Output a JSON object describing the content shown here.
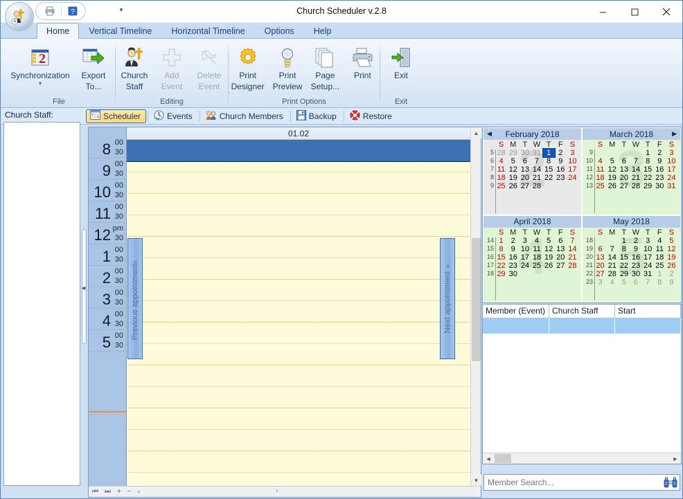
{
  "window": {
    "title": "Church Scheduler v.2.8",
    "app_icon": "church-staff-orb-icon",
    "minimize_label": "Minimize",
    "maximize_label": "Maximize",
    "close_label": "Close"
  },
  "quick_access": {
    "items": [
      {
        "name": "print-icon",
        "label": "Print"
      },
      {
        "name": "help-icon",
        "label": "Help"
      }
    ],
    "customize_label": "Customize Quick Access Toolbar"
  },
  "ribbon": {
    "tabs": [
      {
        "label": "Home",
        "active": true
      },
      {
        "label": "Vertical Timeline",
        "active": false
      },
      {
        "label": "Horizontal Timeline",
        "active": false
      },
      {
        "label": "Options",
        "active": false
      },
      {
        "label": "Help",
        "active": false
      }
    ],
    "groups": [
      {
        "label": "File",
        "items": [
          {
            "label1": "Synchronization",
            "label2": "",
            "icon": "synchronization-icon",
            "disabled": false,
            "dropdown": true
          },
          {
            "label1": "Export",
            "label2": "To...",
            "icon": "export-to-icon",
            "disabled": false,
            "dropdown": true
          }
        ]
      },
      {
        "label": "Editing",
        "items": [
          {
            "label1": "Church",
            "label2": "Staff",
            "icon": "church-staff-icon",
            "disabled": false,
            "dropdown": false
          },
          {
            "label1": "Add",
            "label2": "Event",
            "icon": "add-event-icon",
            "disabled": true,
            "dropdown": false
          },
          {
            "label1": "Delete",
            "label2": "Event",
            "icon": "delete-event-icon",
            "disabled": true,
            "dropdown": true
          }
        ]
      },
      {
        "label": "Print Options",
        "items": [
          {
            "label1": "Print",
            "label2": "Designer",
            "icon": "print-designer-icon",
            "disabled": false,
            "dropdown": false
          },
          {
            "label1": "Print",
            "label2": "Preview",
            "icon": "print-preview-icon",
            "disabled": false,
            "dropdown": false
          },
          {
            "label1": "Page",
            "label2": "Setup...",
            "icon": "page-setup-icon",
            "disabled": false,
            "dropdown": false
          },
          {
            "label1": "Print",
            "label2": "",
            "icon": "print-icon",
            "disabled": false,
            "dropdown": false
          }
        ]
      },
      {
        "label": "Exit",
        "items": [
          {
            "label1": "Exit",
            "label2": "",
            "icon": "exit-icon",
            "disabled": false,
            "dropdown": false
          }
        ]
      }
    ]
  },
  "nav_tabs": [
    {
      "label": "Scheduler",
      "icon": "scheduler-grid-icon",
      "active": true
    },
    {
      "label": "Events",
      "icon": "events-clock-icon",
      "active": false
    },
    {
      "label": "Church Members",
      "icon": "church-members-icon",
      "active": false
    },
    {
      "label": "Backup",
      "icon": "backup-floppy-icon",
      "active": false
    },
    {
      "label": "Restore",
      "icon": "restore-lifering-icon",
      "active": false
    }
  ],
  "staff_panel": {
    "title": "Church Staff:",
    "items": []
  },
  "scheduler": {
    "date_header": "01.02",
    "prev_appointment_label": "Previous appointment",
    "next_appointment_label": "Next appointment",
    "prev_chevron": "«",
    "next_chevron": "»",
    "time_rows": [
      {
        "hour": "8",
        "suffix": "00",
        "half": "30"
      },
      {
        "hour": "9",
        "suffix": "00",
        "half": "30"
      },
      {
        "hour": "10",
        "suffix": "00",
        "half": "30"
      },
      {
        "hour": "11",
        "suffix": "00",
        "half": "30"
      },
      {
        "hour": "12",
        "suffix": "pm",
        "half": "30"
      },
      {
        "hour": "1",
        "suffix": "00",
        "half": "30"
      },
      {
        "hour": "2",
        "suffix": "00",
        "half": "30"
      },
      {
        "hour": "3",
        "suffix": "00",
        "half": "30"
      },
      {
        "hour": "4",
        "suffix": "00",
        "half": "30"
      },
      {
        "hour": "5",
        "suffix": "00",
        "half": "30"
      }
    ],
    "nav_buttons": [
      {
        "name": "first-record-button",
        "glyph": "⏮"
      },
      {
        "name": "last-record-button",
        "glyph": "⏭"
      },
      {
        "name": "add-record-button",
        "glyph": "+"
      },
      {
        "name": "delete-record-button",
        "glyph": "−"
      },
      {
        "name": "prev-record-button",
        "glyph": "‹"
      },
      {
        "name": "next-record-button",
        "glyph": "›"
      }
    ]
  },
  "calendars": [
    {
      "title": "February 2018",
      "watermark": "2",
      "theme": "grey",
      "nav": "prev",
      "nav_glyph": "◀",
      "dow": [
        "S",
        "M",
        "T",
        "W",
        "T",
        "F",
        "S"
      ],
      "weeks": [
        {
          "wn": "5",
          "days": [
            {
              "d": "28",
              "t": "out-we"
            },
            {
              "d": "29",
              "t": "out"
            },
            {
              "d": "30",
              "t": "out"
            },
            {
              "d": "31",
              "t": "out"
            },
            {
              "d": "1",
              "t": "sel"
            },
            {
              "d": "2",
              "t": "nor"
            },
            {
              "d": "3",
              "t": "we"
            }
          ]
        },
        {
          "wn": "6",
          "days": [
            {
              "d": "4",
              "t": "we"
            },
            {
              "d": "5",
              "t": "nor"
            },
            {
              "d": "6",
              "t": "nor"
            },
            {
              "d": "7",
              "t": "nor"
            },
            {
              "d": "8",
              "t": "nor"
            },
            {
              "d": "9",
              "t": "nor"
            },
            {
              "d": "10",
              "t": "we"
            }
          ]
        },
        {
          "wn": "7",
          "days": [
            {
              "d": "11",
              "t": "we"
            },
            {
              "d": "12",
              "t": "nor"
            },
            {
              "d": "13",
              "t": "nor"
            },
            {
              "d": "14",
              "t": "nor"
            },
            {
              "d": "15",
              "t": "nor"
            },
            {
              "d": "16",
              "t": "nor"
            },
            {
              "d": "17",
              "t": "we"
            }
          ]
        },
        {
          "wn": "8",
          "days": [
            {
              "d": "18",
              "t": "we"
            },
            {
              "d": "19",
              "t": "nor"
            },
            {
              "d": "20",
              "t": "nor"
            },
            {
              "d": "21",
              "t": "nor"
            },
            {
              "d": "22",
              "t": "nor"
            },
            {
              "d": "23",
              "t": "nor"
            },
            {
              "d": "24",
              "t": "we"
            }
          ]
        },
        {
          "wn": "9",
          "days": [
            {
              "d": "25",
              "t": "we"
            },
            {
              "d": "26",
              "t": "nor"
            },
            {
              "d": "27",
              "t": "nor"
            },
            {
              "d": "28",
              "t": "nor"
            },
            {
              "d": "",
              "t": "nor"
            },
            {
              "d": "",
              "t": "nor"
            },
            {
              "d": "",
              "t": "nor"
            }
          ]
        }
      ]
    },
    {
      "title": "March 2018",
      "watermark": "3",
      "theme": "green",
      "nav": "next",
      "nav_glyph": "▶",
      "dow": [
        "S",
        "M",
        "T",
        "W",
        "T",
        "F",
        "S"
      ],
      "weeks": [
        {
          "wn": "9",
          "days": [
            {
              "d": "",
              "t": "nor"
            },
            {
              "d": "",
              "t": "nor"
            },
            {
              "d": "",
              "t": "nor"
            },
            {
              "d": "",
              "t": "nor"
            },
            {
              "d": "1",
              "t": "nor"
            },
            {
              "d": "2",
              "t": "nor"
            },
            {
              "d": "3",
              "t": "we"
            }
          ]
        },
        {
          "wn": "10",
          "days": [
            {
              "d": "4",
              "t": "we"
            },
            {
              "d": "5",
              "t": "nor"
            },
            {
              "d": "6",
              "t": "nor"
            },
            {
              "d": "7",
              "t": "nor"
            },
            {
              "d": "8",
              "t": "nor"
            },
            {
              "d": "9",
              "t": "nor"
            },
            {
              "d": "10",
              "t": "we"
            }
          ]
        },
        {
          "wn": "11",
          "days": [
            {
              "d": "11",
              "t": "we"
            },
            {
              "d": "12",
              "t": "nor"
            },
            {
              "d": "13",
              "t": "nor"
            },
            {
              "d": "14",
              "t": "nor"
            },
            {
              "d": "15",
              "t": "nor"
            },
            {
              "d": "16",
              "t": "nor"
            },
            {
              "d": "17",
              "t": "we"
            }
          ]
        },
        {
          "wn": "12",
          "days": [
            {
              "d": "18",
              "t": "we"
            },
            {
              "d": "19",
              "t": "nor"
            },
            {
              "d": "20",
              "t": "nor"
            },
            {
              "d": "21",
              "t": "nor"
            },
            {
              "d": "22",
              "t": "nor"
            },
            {
              "d": "23",
              "t": "nor"
            },
            {
              "d": "24",
              "t": "we"
            }
          ]
        },
        {
          "wn": "13",
          "days": [
            {
              "d": "25",
              "t": "we"
            },
            {
              "d": "26",
              "t": "nor"
            },
            {
              "d": "27",
              "t": "nor"
            },
            {
              "d": "28",
              "t": "nor"
            },
            {
              "d": "29",
              "t": "nor"
            },
            {
              "d": "30",
              "t": "nor"
            },
            {
              "d": "31",
              "t": "we"
            }
          ]
        }
      ]
    },
    {
      "title": "April 2018",
      "watermark": "4",
      "theme": "green",
      "nav": "none",
      "nav_glyph": "",
      "dow": [
        "S",
        "M",
        "T",
        "W",
        "T",
        "F",
        "S"
      ],
      "weeks": [
        {
          "wn": "14",
          "days": [
            {
              "d": "1",
              "t": "we"
            },
            {
              "d": "2",
              "t": "nor"
            },
            {
              "d": "3",
              "t": "nor"
            },
            {
              "d": "4",
              "t": "nor"
            },
            {
              "d": "5",
              "t": "nor"
            },
            {
              "d": "6",
              "t": "nor"
            },
            {
              "d": "7",
              "t": "we"
            }
          ]
        },
        {
          "wn": "15",
          "days": [
            {
              "d": "8",
              "t": "we"
            },
            {
              "d": "9",
              "t": "nor"
            },
            {
              "d": "10",
              "t": "nor"
            },
            {
              "d": "11",
              "t": "nor"
            },
            {
              "d": "12",
              "t": "nor"
            },
            {
              "d": "13",
              "t": "nor"
            },
            {
              "d": "14",
              "t": "we"
            }
          ]
        },
        {
          "wn": "16",
          "days": [
            {
              "d": "15",
              "t": "we"
            },
            {
              "d": "16",
              "t": "nor"
            },
            {
              "d": "17",
              "t": "nor"
            },
            {
              "d": "18",
              "t": "nor"
            },
            {
              "d": "19",
              "t": "nor"
            },
            {
              "d": "20",
              "t": "nor"
            },
            {
              "d": "21",
              "t": "we"
            }
          ]
        },
        {
          "wn": "17",
          "days": [
            {
              "d": "22",
              "t": "we"
            },
            {
              "d": "23",
              "t": "nor"
            },
            {
              "d": "24",
              "t": "nor"
            },
            {
              "d": "25",
              "t": "nor"
            },
            {
              "d": "26",
              "t": "nor"
            },
            {
              "d": "27",
              "t": "nor"
            },
            {
              "d": "28",
              "t": "we"
            }
          ]
        },
        {
          "wn": "18",
          "days": [
            {
              "d": "29",
              "t": "we"
            },
            {
              "d": "30",
              "t": "nor"
            },
            {
              "d": "",
              "t": "nor"
            },
            {
              "d": "",
              "t": "nor"
            },
            {
              "d": "",
              "t": "nor"
            },
            {
              "d": "",
              "t": "nor"
            },
            {
              "d": "",
              "t": "nor"
            }
          ]
        }
      ]
    },
    {
      "title": "May 2018",
      "watermark": "5",
      "theme": "green",
      "nav": "none",
      "nav_glyph": "",
      "dow": [
        "S",
        "M",
        "T",
        "W",
        "T",
        "F",
        "S"
      ],
      "weeks": [
        {
          "wn": "18",
          "days": [
            {
              "d": "",
              "t": "nor"
            },
            {
              "d": "",
              "t": "nor"
            },
            {
              "d": "1",
              "t": "nor"
            },
            {
              "d": "2",
              "t": "nor"
            },
            {
              "d": "3",
              "t": "nor"
            },
            {
              "d": "4",
              "t": "nor"
            },
            {
              "d": "5",
              "t": "we"
            }
          ]
        },
        {
          "wn": "19",
          "days": [
            {
              "d": "6",
              "t": "we"
            },
            {
              "d": "7",
              "t": "nor"
            },
            {
              "d": "8",
              "t": "nor"
            },
            {
              "d": "9",
              "t": "nor"
            },
            {
              "d": "10",
              "t": "nor"
            },
            {
              "d": "11",
              "t": "nor"
            },
            {
              "d": "12",
              "t": "we"
            }
          ]
        },
        {
          "wn": "20",
          "days": [
            {
              "d": "13",
              "t": "we"
            },
            {
              "d": "14",
              "t": "nor"
            },
            {
              "d": "15",
              "t": "nor"
            },
            {
              "d": "16",
              "t": "nor"
            },
            {
              "d": "17",
              "t": "nor"
            },
            {
              "d": "18",
              "t": "nor"
            },
            {
              "d": "19",
              "t": "we"
            }
          ]
        },
        {
          "wn": "21",
          "days": [
            {
              "d": "20",
              "t": "we"
            },
            {
              "d": "21",
              "t": "nor"
            },
            {
              "d": "22",
              "t": "nor"
            },
            {
              "d": "23",
              "t": "nor"
            },
            {
              "d": "24",
              "t": "nor"
            },
            {
              "d": "25",
              "t": "nor"
            },
            {
              "d": "26",
              "t": "we"
            }
          ]
        },
        {
          "wn": "22",
          "days": [
            {
              "d": "27",
              "t": "we"
            },
            {
              "d": "28",
              "t": "nor"
            },
            {
              "d": "29",
              "t": "nor"
            },
            {
              "d": "30",
              "t": "nor"
            },
            {
              "d": "31",
              "t": "nor"
            },
            {
              "d": "1",
              "t": "out"
            },
            {
              "d": "2",
              "t": "out-we"
            }
          ]
        },
        {
          "wn": "23",
          "days": [
            {
              "d": "3",
              "t": "out-we"
            },
            {
              "d": "4",
              "t": "out"
            },
            {
              "d": "5",
              "t": "out"
            },
            {
              "d": "6",
              "t": "out"
            },
            {
              "d": "7",
              "t": "out"
            },
            {
              "d": "8",
              "t": "out"
            },
            {
              "d": "9",
              "t": "out-we"
            }
          ]
        }
      ]
    }
  ],
  "event_table": {
    "columns": [
      "Member (Event)",
      "Church Staff",
      "Start"
    ],
    "rows": [
      {
        "cells": [
          "",
          "",
          ""
        ],
        "selected": true
      }
    ]
  },
  "member_search": {
    "placeholder": "Member Search...",
    "value": "",
    "button_icon": "binoculars-icon"
  },
  "colors": {
    "accent": "#3c6fb4",
    "calendar_selected": "#1055c0",
    "weekend_text": "#c00000",
    "grid_background": "#fdfbda",
    "now_line": "#e8904a",
    "active_tab": "#ffd978"
  }
}
